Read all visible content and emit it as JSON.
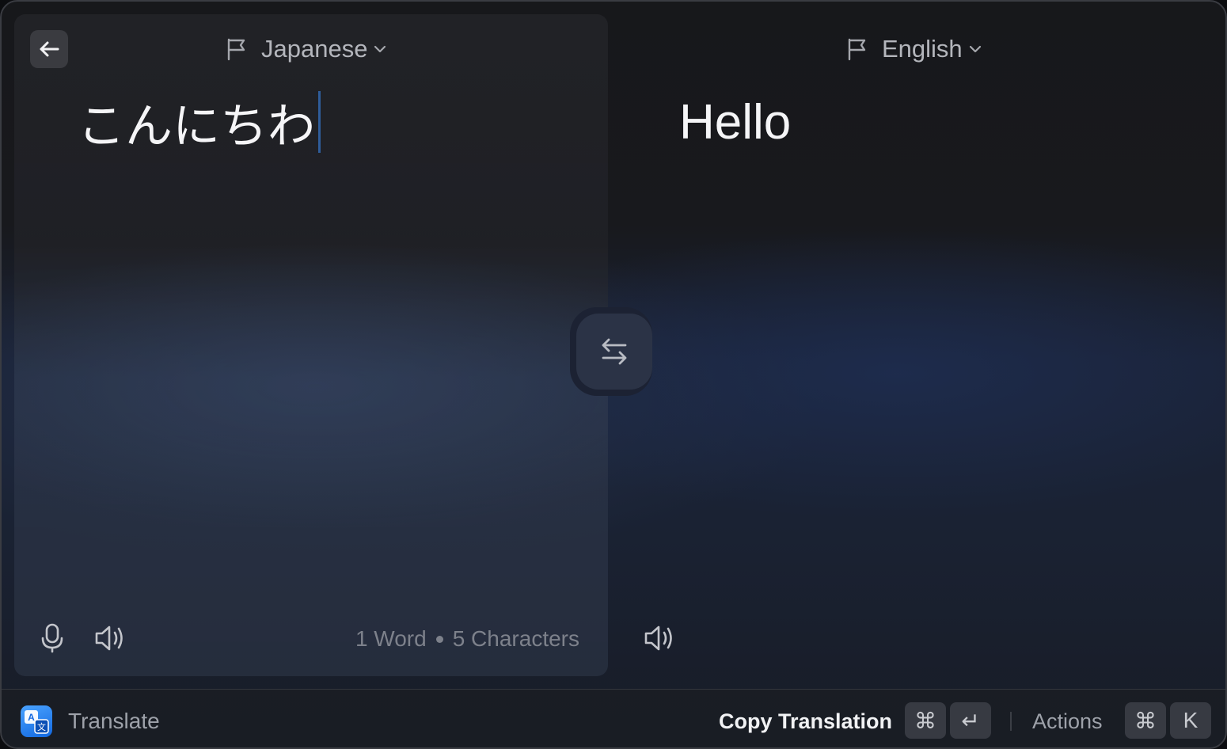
{
  "source": {
    "language": "Japanese",
    "text": "こんにちわ",
    "word_count": "1 Word",
    "char_count": "5 Characters"
  },
  "target": {
    "language": "English",
    "text": "Hello"
  },
  "footer": {
    "app_name": "Translate",
    "primary_action": "Copy Translation",
    "primary_keys": [
      "⌘",
      "↵"
    ],
    "actions_label": "Actions",
    "actions_keys": [
      "⌘",
      "K"
    ]
  },
  "icons": {
    "back": "arrow-left-icon",
    "flag": "flag-icon",
    "chevron": "chevron-down-icon",
    "swap": "swap-arrows-icon",
    "mic": "microphone-icon",
    "speaker": "speaker-icon",
    "app": "translate-app-icon"
  },
  "colors": {
    "caret": "#2f5d9a",
    "app_icon": "#1268e0"
  }
}
